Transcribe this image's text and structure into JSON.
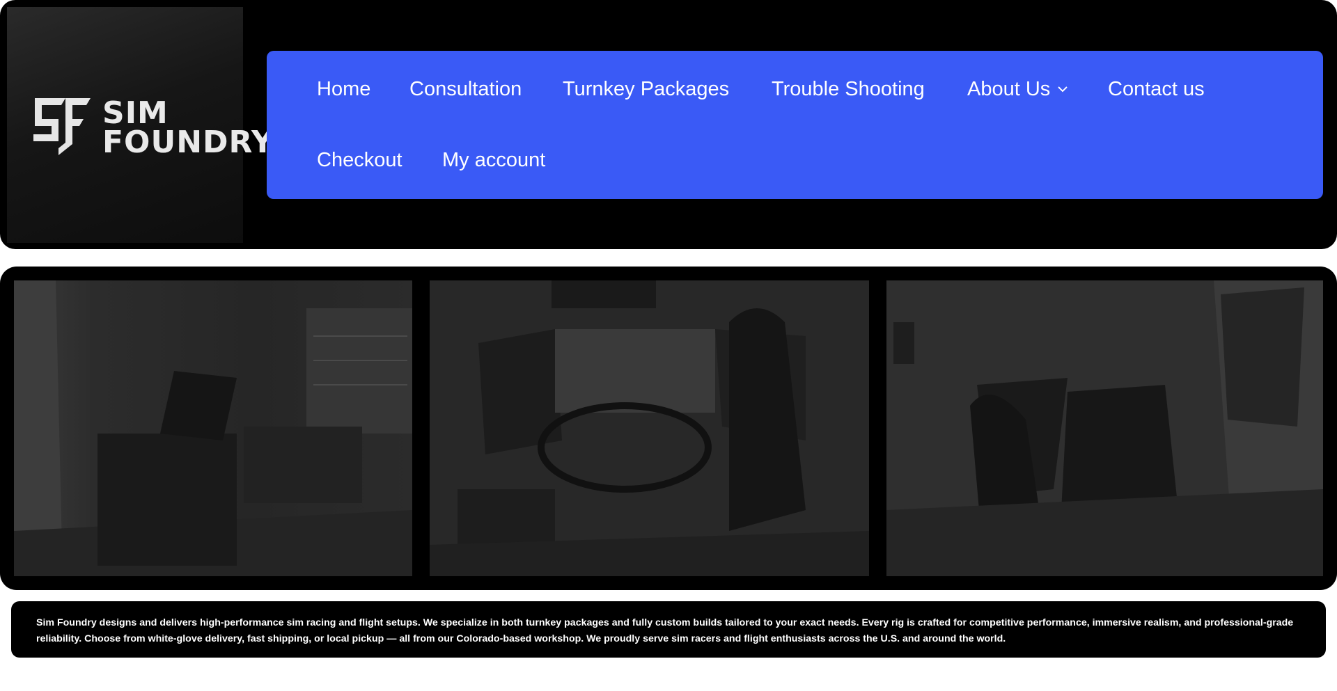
{
  "brand": {
    "line1": "SIM",
    "line2": "FOUNDRY"
  },
  "nav": {
    "items": [
      {
        "label": "Home"
      },
      {
        "label": "Consultation"
      },
      {
        "label": "Turnkey Packages"
      },
      {
        "label": "Trouble Shooting"
      },
      {
        "label": "About Us",
        "has_dropdown": true
      },
      {
        "label": "Contact us"
      },
      {
        "label": "Checkout"
      },
      {
        "label": "My account"
      }
    ],
    "background_color": "#3a5af6"
  },
  "intro": {
    "lead": "Sim Foundry designs and delivers high-performance sim racing and flight setups.",
    "body": " We specialize in both turnkey packages and fully custom builds tailored to your exact needs. Every rig is crafted for competitive performance, immersive realism, and professional-grade reliability. Choose from white-glove delivery, fast shipping, or local pickup — all from our Colorado-based workshop. We proudly serve sim racers and flight enthusiasts across the U.S. and around the world."
  },
  "icons": {
    "logo": "sf-logo-icon",
    "dropdown": "chevron-down-icon"
  }
}
